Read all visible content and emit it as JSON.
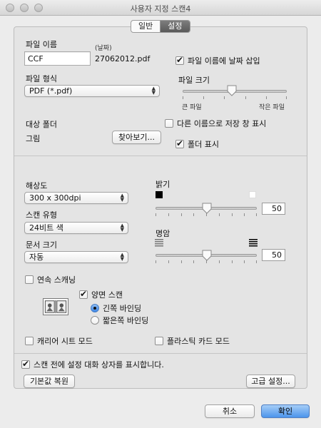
{
  "window": {
    "title": "사용자 지정 스캔4"
  },
  "tabs": [
    {
      "label": "일반",
      "active": false
    },
    {
      "label": "설정",
      "active": true
    }
  ],
  "file": {
    "name_label": "파일 이름",
    "date_hint": "(날짜)",
    "name_value": "CCF",
    "name_suffix": "27062012.pdf",
    "insert_date_label": "파일 이름에 날짜 삽입",
    "insert_date_checked": true,
    "type_label": "파일 형식",
    "type_value": "PDF (*.pdf)",
    "size_label": "파일 크기",
    "size_large": "큰 파일",
    "size_small": "작은 파일",
    "size_slider_fraction": 0.5
  },
  "folder": {
    "label": "대상 폴더",
    "value": "그림",
    "browse_label": "찾아보기...",
    "save_as_label": "다른 이름으로 저장 창 표시",
    "save_as_checked": false,
    "show_folder_label": "폴더 표시",
    "show_folder_checked": true
  },
  "scan": {
    "resolution_label": "해상도",
    "resolution_value": "300 x 300dpi",
    "type_label": "스캔 유형",
    "type_value": "24비트 색",
    "doc_size_label": "문서 크기",
    "doc_size_value": "자동",
    "brightness_label": "밝기",
    "brightness_value": "50",
    "contrast_label": "명암",
    "contrast_value": "50",
    "continuous_label": "연속 스캐닝",
    "continuous_checked": false,
    "duplex_label": "양면 스캔",
    "duplex_checked": true,
    "long_edge_label": "긴쪽 바인딩",
    "long_edge_selected": true,
    "short_edge_label": "짧은쪽 바인딩",
    "short_edge_selected": false,
    "carrier_label": "캐리어 시트 모드",
    "carrier_checked": false,
    "plastic_label": "플라스틱 카드 모드",
    "plastic_checked": false
  },
  "bottom": {
    "show_dialog_label": "스캔 전에 설정 대화 상자를 표시합니다.",
    "show_dialog_checked": true,
    "restore_label": "기본값 복원",
    "advanced_label": "고급 설정...",
    "cancel_label": "취소",
    "ok_label": "확인"
  },
  "colors": {
    "accent": "#4c95ec"
  }
}
